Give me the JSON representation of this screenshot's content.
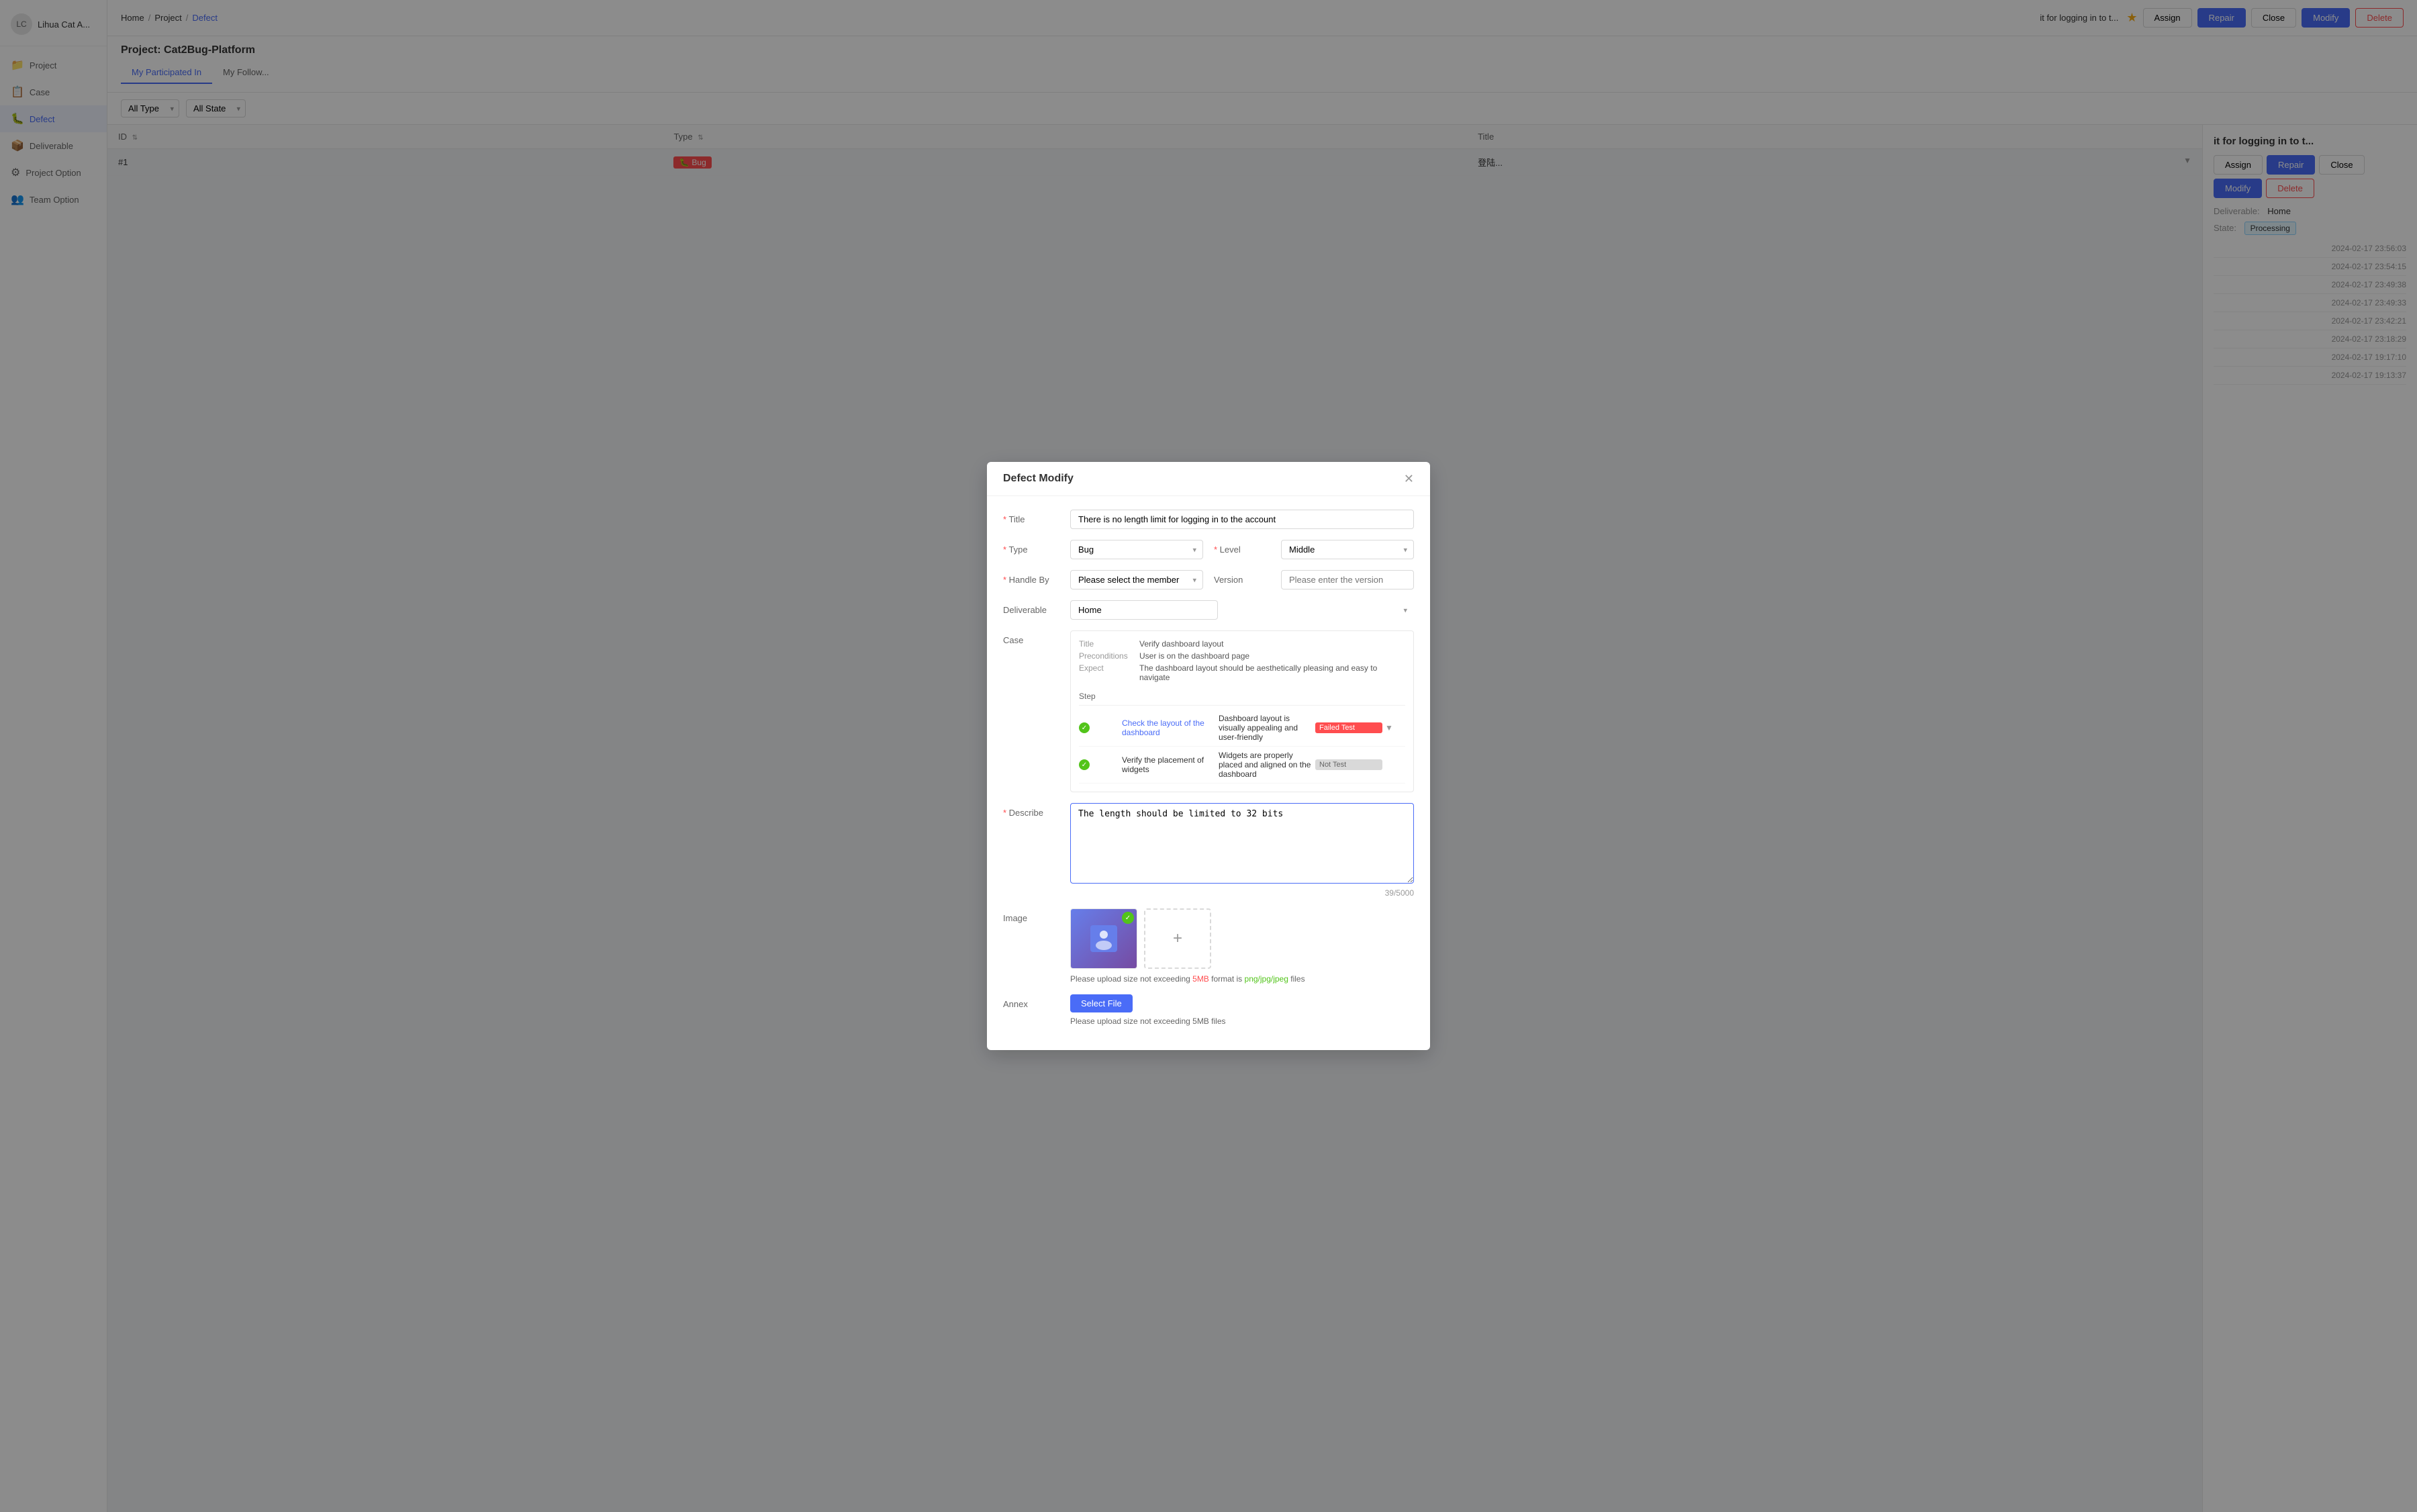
{
  "sidebar": {
    "username": "Lihua Cat A...",
    "avatar_text": "LC",
    "items": [
      {
        "id": "menu",
        "label": "",
        "icon": "☰",
        "active": false
      },
      {
        "id": "project",
        "label": "Project",
        "icon": "📁",
        "active": false
      },
      {
        "id": "case",
        "label": "Case",
        "icon": "📋",
        "active": false
      },
      {
        "id": "defect",
        "label": "Defect",
        "icon": "🐛",
        "active": true
      },
      {
        "id": "deliverable",
        "label": "Deliverable",
        "icon": "📦",
        "active": false
      },
      {
        "id": "project-option",
        "label": "Project Option",
        "icon": "⚙",
        "active": false
      },
      {
        "id": "team-option",
        "label": "Team Option",
        "icon": "👥",
        "active": false
      }
    ]
  },
  "topbar": {
    "breadcrumbs": [
      "Home",
      "Project",
      "Defect"
    ],
    "defect_title": "it for logging in to t...",
    "star": "★",
    "buttons": {
      "assign": "Assign",
      "repair": "Repair",
      "close": "Close",
      "modify": "Modify",
      "delete": "Delete"
    }
  },
  "project": {
    "title": "Project: Cat2Bug-Platform",
    "tabs": [
      {
        "id": "participated",
        "label": "My Participated In",
        "active": true
      },
      {
        "id": "followed",
        "label": "My Follow...",
        "active": false
      }
    ]
  },
  "filters": {
    "type_label": "All Type",
    "state_label": "All State"
  },
  "table": {
    "columns": [
      "ID",
      "Type",
      "Title"
    ],
    "rows": [
      {
        "id": "#1",
        "type": "Bug",
        "title": "登陆..."
      }
    ]
  },
  "right_panel": {
    "title": "it for logging in to t...",
    "deliverable_label": "Deliverable:",
    "deliverable_value": "Home",
    "state_label": "State:",
    "state_value": "Processing",
    "timestamps": [
      "2024-02-17 23:56:03",
      "2024-02-17 23:54:15",
      "2024-02-17 23:49:38",
      "2024-02-17 23:49:33",
      "2024-02-17 23:42:21",
      "2024-02-17 23:18:29",
      "2024-02-17 19:17:10",
      "2024-02-17 19:13:37"
    ]
  },
  "modal": {
    "title": "Defect Modify",
    "fields": {
      "title_label": "Title",
      "title_value": "There is no length limit for logging in to the account",
      "type_label": "Type",
      "type_value": "Bug",
      "level_label": "Level",
      "level_value": "Middle",
      "handle_by_label": "Handle By",
      "handle_by_placeholder": "Please select the member",
      "version_label": "Version",
      "version_placeholder": "Please enter the version",
      "deliverable_label": "Deliverable",
      "deliverable_value": "Home",
      "case_label": "Case",
      "describe_label": "Describe",
      "describe_value": "The length should be limited to 32 bits",
      "describe_counter": "39/5000",
      "image_label": "Image",
      "annex_label": "Annex"
    },
    "case": {
      "title_label": "Title",
      "title_value": "Verify dashboard layout",
      "preconditions_label": "Preconditions",
      "preconditions_value": "User is on the dashboard page",
      "expect_label": "Expect",
      "expect_value": "The dashboard layout should be aesthetically pleasing and easy to navigate",
      "step_label": "Step",
      "steps": [
        {
          "id": 1,
          "check": "✓",
          "check_type": "fail",
          "action": "Check the layout of the dashboard",
          "result": "Dashboard layout is visually appealing and user-friendly",
          "status": "Failed Test",
          "status_type": "fail"
        },
        {
          "id": 2,
          "check": "✓",
          "check_type": "pass",
          "action": "Verify the placement of widgets",
          "result": "Widgets are properly placed and aligned on the dashboard",
          "status": "Not Test",
          "status_type": "nottest"
        }
      ]
    },
    "image_upload": {
      "hint_prefix": "Please upload size not exceeding ",
      "size_limit": "5MB",
      "format_label": "format is ",
      "format_value": "png/jpg/jpeg",
      "hint_suffix": " files"
    },
    "annex": {
      "select_file_btn": "Select File",
      "hint_prefix": "Please upload size not exceeding ",
      "size_limit": "5MB",
      "hint_suffix": " files"
    }
  }
}
